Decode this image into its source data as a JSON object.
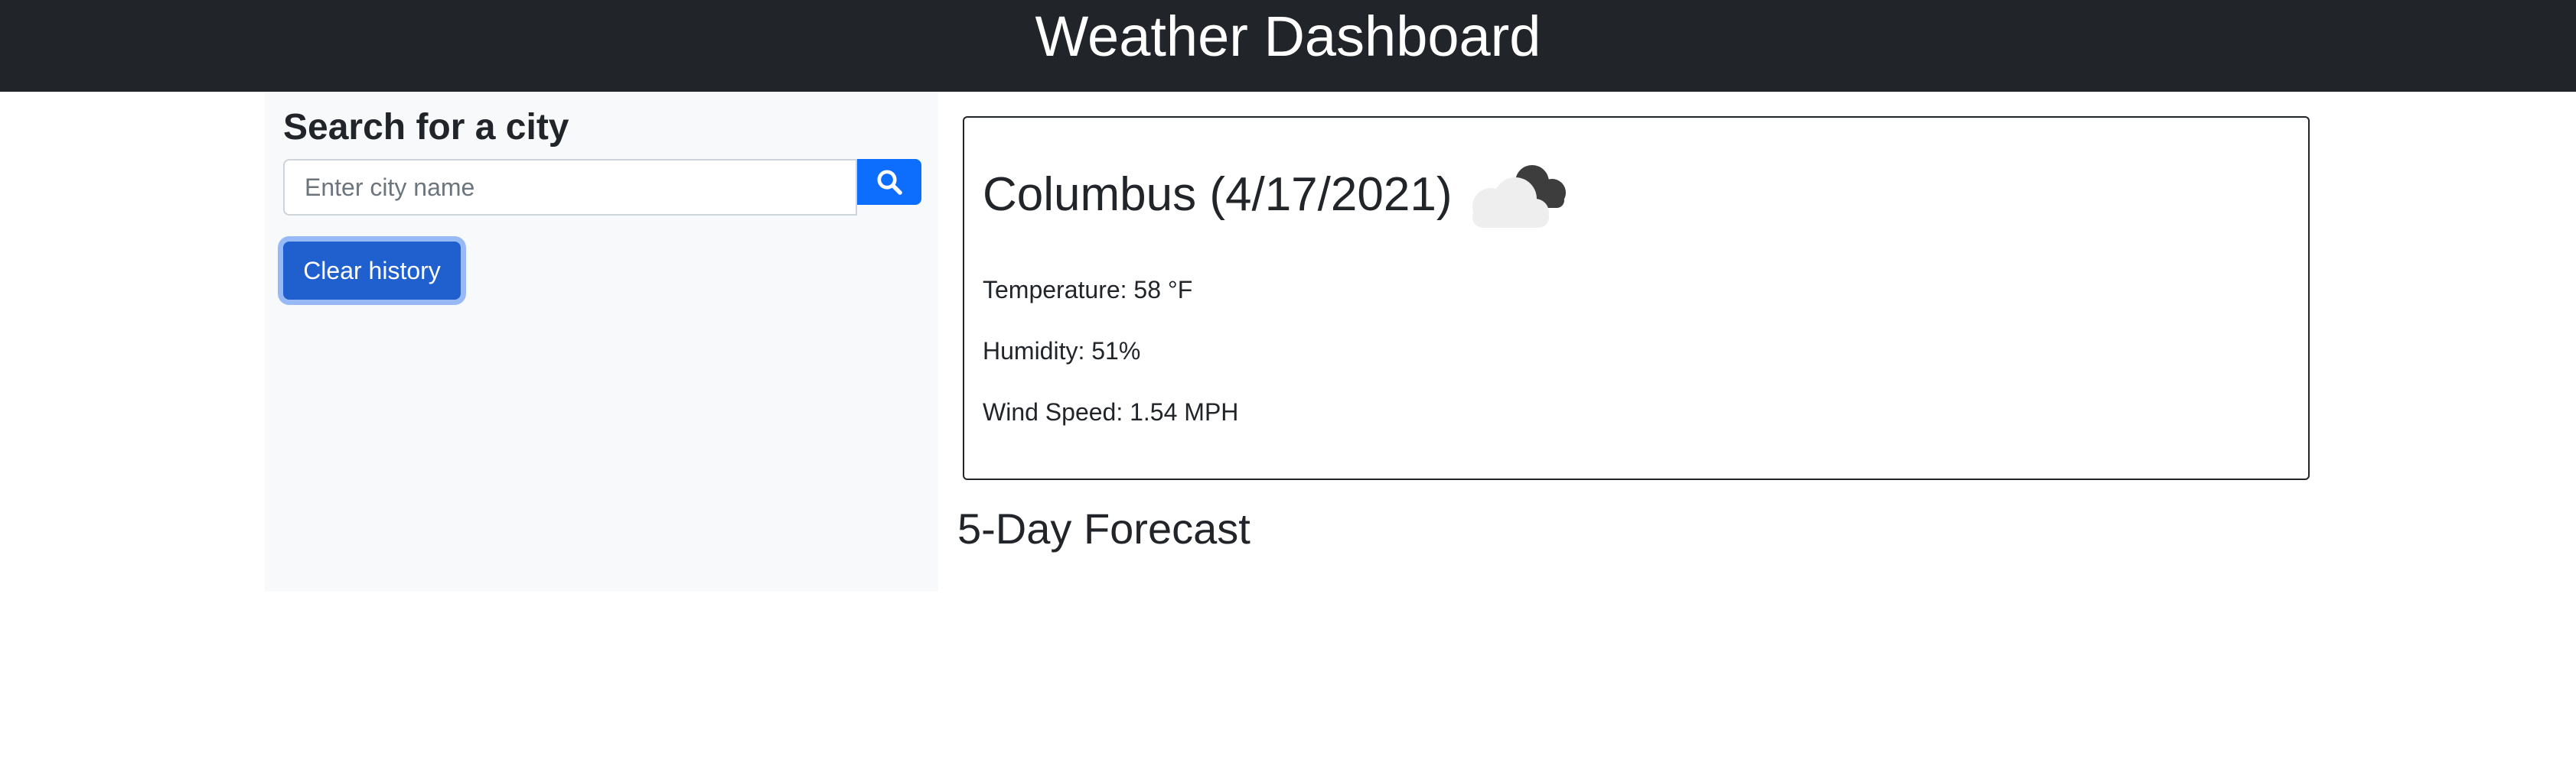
{
  "header": {
    "title": "Weather Dashboard"
  },
  "sidebar": {
    "title": "Search for a city",
    "search": {
      "placeholder": "Enter city name",
      "value": "",
      "button_icon": "search-icon"
    },
    "clear_button_label": "Clear history"
  },
  "current": {
    "title": "Columbus (4/17/2021)",
    "icon": "cloud-icon",
    "temperature": "Temperature: 58 °F",
    "humidity": "Humidity: 51%",
    "wind": "Wind Speed: 1.54 MPH"
  },
  "forecast": {
    "title": "5-Day Forecast"
  },
  "colors": {
    "navbar": "#212529",
    "sidebar_bg": "#f8f9fa",
    "primary": "#0d6efd"
  }
}
